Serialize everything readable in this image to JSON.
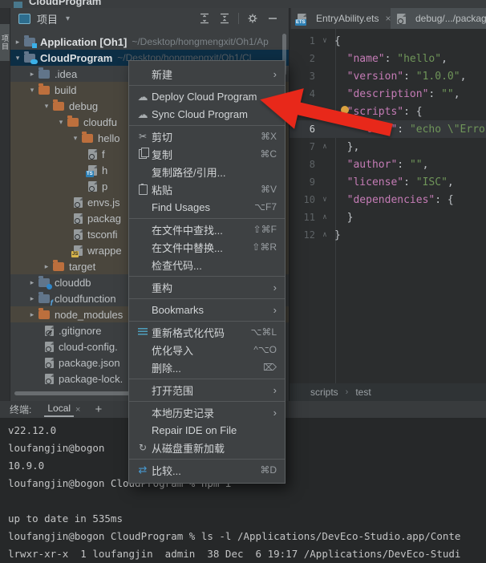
{
  "window": {
    "title": "CloudProgram"
  },
  "tool_stripe": {
    "label": "项目"
  },
  "icons": {
    "caret": "▾",
    "close": "×",
    "plus": "+",
    "submenu": "›",
    "chev_open": "▾",
    "chev_closed": "▸",
    "fold_open": "∨",
    "fold_close": "∧",
    "cut": "✂",
    "refresh": "↻",
    "compare": "⇄",
    "cloud": "☁",
    "up": "↑",
    "down": "↓",
    "ts_badge": "TS",
    "js_badge": "JS",
    "ets_badge": "ETS",
    "bc_sep": "›"
  },
  "colors": {
    "accent_blue": "#3bb0e8",
    "folder_orange": "#bc6f3d",
    "selection_blue": "#0c2e45",
    "arrow_red": "#e8281a",
    "json_key": "#c57cb6",
    "json_string": "#6f9559",
    "excluded_row": "#4a463d"
  },
  "project_panel": {
    "header": {
      "title": "项目"
    },
    "tree": [
      {
        "label": "Application [Oh1]",
        "path": "~/Desktop/hongmengxit/Oh1/Ap",
        "level": 0,
        "chevron": "closed",
        "icon": "folder",
        "fc": "gray",
        "badge": "sq",
        "bold": true
      },
      {
        "label": "CloudProgram",
        "path": "~/Desktop/hongmengxit/Oh1/Cl",
        "dim": true,
        "level": 0,
        "chevron": "open",
        "icon": "folder",
        "fc": "gray",
        "badge": "cloud",
        "bold": true,
        "sel": true
      },
      {
        "label": ".idea",
        "level": 1,
        "chevron": "closed",
        "icon": "folder",
        "fc": "gray"
      },
      {
        "label": "build",
        "level": 1,
        "chevron": "open",
        "icon": "folder",
        "fc": "orange",
        "brown": true
      },
      {
        "label": "debug",
        "level": 2,
        "chevron": "open",
        "icon": "folder",
        "fc": "orange",
        "brown": true
      },
      {
        "label": "cloudfu",
        "level": 3,
        "chevron": "open",
        "icon": "folder",
        "fc": "orange",
        "brown": true
      },
      {
        "label": "hello",
        "level": 4,
        "chevron": "open",
        "icon": "folder",
        "fc": "orange",
        "brown": true
      },
      {
        "label": "f",
        "level": 5,
        "icon": "json",
        "brown": true
      },
      {
        "label": "h",
        "level": 5,
        "icon": "ts",
        "brown": true
      },
      {
        "label": "p",
        "level": 5,
        "icon": "json",
        "brown": true
      },
      {
        "label": "envs.js",
        "level": 4,
        "icon": "json",
        "brown": true
      },
      {
        "label": "packag",
        "level": 4,
        "icon": "json",
        "brown": true
      },
      {
        "label": "tsconfi",
        "level": 4,
        "icon": "json",
        "brown": true
      },
      {
        "label": "wrappe",
        "level": 4,
        "icon": "js",
        "brown": true
      },
      {
        "label": "target",
        "level": 2,
        "chevron": "closed",
        "icon": "folder",
        "fc": "orange",
        "brown": true
      },
      {
        "label": "clouddb",
        "level": 1,
        "chevron": "closed",
        "icon": "folder",
        "fc": "gray",
        "badge": "db"
      },
      {
        "label": "cloudfunction",
        "level": 1,
        "chevron": "closed",
        "icon": "folder",
        "fc": "gray",
        "badge": "fn"
      },
      {
        "label": "node_modules",
        "level": 1,
        "chevron": "closed",
        "icon": "folder",
        "fc": "orange",
        "brown": true
      },
      {
        "label": ".gitignore",
        "level": 2,
        "icon": "ignore"
      },
      {
        "label": "cloud-config.",
        "level": 2,
        "icon": "json"
      },
      {
        "label": "package.json",
        "level": 2,
        "icon": "json"
      },
      {
        "label": "package-lock.",
        "level": 2,
        "icon": "json"
      }
    ]
  },
  "editor": {
    "tabs": [
      {
        "label": "EntryAbility.ets",
        "icon": "ets",
        "closable": true
      },
      {
        "label": "debug/.../package.",
        "icon": "json",
        "active": true
      }
    ],
    "breadcrumbs": [
      "scripts",
      "test"
    ],
    "lines": [
      {
        "n": 1,
        "fold": "open",
        "seg": [
          {
            "t": "{",
            "c": "p"
          }
        ]
      },
      {
        "n": 2,
        "seg": [
          {
            "t": "  ",
            "c": "p"
          },
          {
            "t": "\"name\"",
            "c": "k"
          },
          {
            "t": ": ",
            "c": "p"
          },
          {
            "t": "\"hello\"",
            "c": "s"
          },
          {
            "t": ",",
            "c": "p"
          }
        ]
      },
      {
        "n": 3,
        "seg": [
          {
            "t": "  ",
            "c": "p"
          },
          {
            "t": "\"version\"",
            "c": "k"
          },
          {
            "t": ": ",
            "c": "p"
          },
          {
            "t": "\"1.0.0\"",
            "c": "s"
          },
          {
            "t": ",",
            "c": "p"
          }
        ]
      },
      {
        "n": 4,
        "seg": [
          {
            "t": "  ",
            "c": "p"
          },
          {
            "t": "\"description\"",
            "c": "k"
          },
          {
            "t": ": ",
            "c": "p"
          },
          {
            "t": "\"\"",
            "c": "s"
          },
          {
            "t": ",",
            "c": "p"
          }
        ]
      },
      {
        "n": 5,
        "fold": "open",
        "seg": [
          {
            "t": "  ",
            "c": "p"
          },
          {
            "t": "\"scripts\"",
            "c": "k"
          },
          {
            "t": ": {",
            "c": "p"
          }
        ]
      },
      {
        "n": 6,
        "cur": true,
        "seg": [
          {
            "t": "    ",
            "c": "p"
          },
          {
            "t": "\"test\"",
            "c": "k"
          },
          {
            "t": ": ",
            "c": "p"
          },
          {
            "t": "\"echo \\\"Erro",
            "c": "s"
          }
        ]
      },
      {
        "n": 7,
        "fold": "close",
        "seg": [
          {
            "t": "  },",
            "c": "p"
          }
        ]
      },
      {
        "n": 8,
        "seg": [
          {
            "t": "  ",
            "c": "p"
          },
          {
            "t": "\"author\"",
            "c": "k"
          },
          {
            "t": ": ",
            "c": "p"
          },
          {
            "t": "\"\"",
            "c": "s"
          },
          {
            "t": ",",
            "c": "p"
          }
        ]
      },
      {
        "n": 9,
        "seg": [
          {
            "t": "  ",
            "c": "p"
          },
          {
            "t": "\"license\"",
            "c": "k"
          },
          {
            "t": ": ",
            "c": "p"
          },
          {
            "t": "\"ISC\"",
            "c": "s"
          },
          {
            "t": ",",
            "c": "p"
          }
        ]
      },
      {
        "n": 10,
        "fold": "open",
        "seg": [
          {
            "t": "  ",
            "c": "p"
          },
          {
            "t": "\"dependencies\"",
            "c": "k"
          },
          {
            "t": ": {",
            "c": "p"
          }
        ]
      },
      {
        "n": 11,
        "fold": "close",
        "seg": [
          {
            "t": "  }",
            "c": "p"
          }
        ]
      },
      {
        "n": 12,
        "fold": "close",
        "seg": [
          {
            "t": "}",
            "c": "p"
          }
        ]
      }
    ]
  },
  "context_menu": {
    "items": [
      {
        "label": "新建",
        "submenu": true
      },
      {
        "type": "sep"
      },
      {
        "label": "Deploy Cloud Program",
        "icon": "cloud-up"
      },
      {
        "label": "Sync Cloud Program",
        "icon": "cloud-down"
      },
      {
        "type": "sep"
      },
      {
        "label": "剪切",
        "icon": "cut",
        "shortcut": "⌘X"
      },
      {
        "label": "复制",
        "icon": "copy",
        "shortcut": "⌘C"
      },
      {
        "label": "复制路径/引用..."
      },
      {
        "label": "粘贴",
        "icon": "paste",
        "shortcut": "⌘V"
      },
      {
        "label": "Find Usages",
        "shortcut": "⌥F7"
      },
      {
        "type": "sep"
      },
      {
        "label": "在文件中查找...",
        "shortcut": "⇧⌘F"
      },
      {
        "label": "在文件中替换...",
        "shortcut": "⇧⌘R"
      },
      {
        "label": "检查代码..."
      },
      {
        "type": "sep"
      },
      {
        "label": "重构",
        "submenu": true
      },
      {
        "type": "sep"
      },
      {
        "label": "Bookmarks",
        "submenu": true
      },
      {
        "type": "sep"
      },
      {
        "label": "重新格式化代码",
        "icon": "reformat",
        "shortcut": "⌥⌘L"
      },
      {
        "label": "优化导入",
        "shortcut": "^⌥O"
      },
      {
        "label": "删除...",
        "shortcut": "⌦"
      },
      {
        "type": "sep"
      },
      {
        "label": "打开范围",
        "submenu": true
      },
      {
        "type": "sep"
      },
      {
        "label": "本地历史记录",
        "submenu": true
      },
      {
        "label": "Repair IDE on File"
      },
      {
        "label": "从磁盘重新加载",
        "icon": "refresh"
      },
      {
        "type": "sep"
      },
      {
        "label": "比较...",
        "icon": "compare",
        "shortcut": "⌘D"
      }
    ]
  },
  "terminal": {
    "label": "终端:",
    "tab_label": "Local",
    "lines": [
      "v22.12.0",
      "loufangjin@bogon",
      "10.9.0",
      "loufangjin@bogon CloudProgram % npm i",
      "",
      "up to date in 535ms",
      "loufangjin@bogon CloudProgram % ls -l /Applications/DevEco-Studio.app/Conte",
      "lrwxr-xr-x  1 loufangjin  admin  38 Dec  6 19:17 /Applications/DevEco-Studi"
    ]
  }
}
